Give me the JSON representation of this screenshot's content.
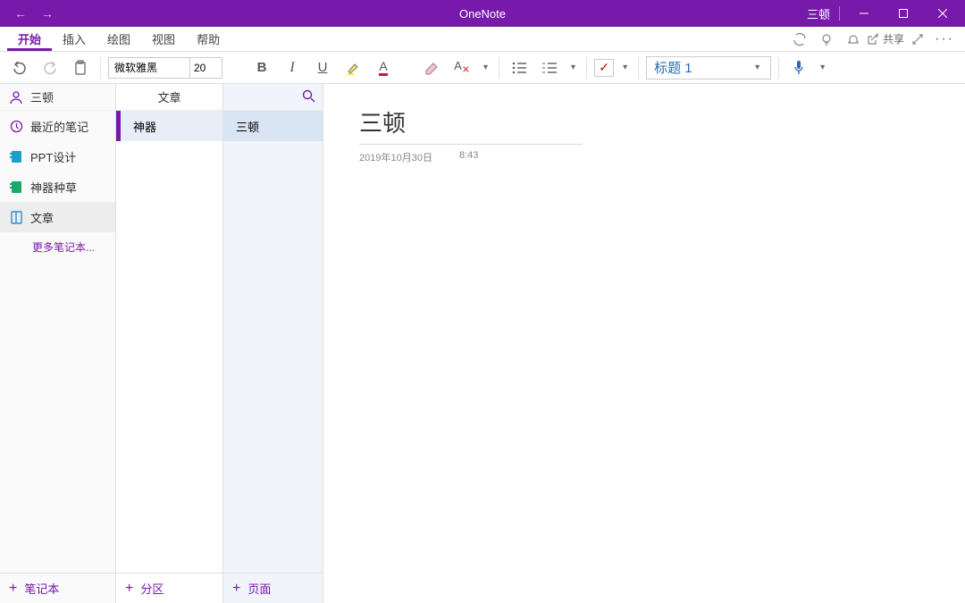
{
  "app": {
    "title": "OneNote",
    "username": "三顿"
  },
  "menu": {
    "tabs": [
      "开始",
      "插入",
      "绘图",
      "视图",
      "帮助"
    ],
    "active": 0,
    "share": "共享"
  },
  "ribbon": {
    "font_name": "微软雅黑",
    "font_size": "20",
    "style_name": "标题 1"
  },
  "sidebar": {
    "user": "三顿",
    "items": [
      {
        "label": "最近的笔记",
        "icon": "clock",
        "color": "#7719AA"
      },
      {
        "label": "PPT设计",
        "icon": "notebook",
        "color": "#1aa0c9"
      },
      {
        "label": "神器种草",
        "icon": "notebook",
        "color": "#1aa86d"
      },
      {
        "label": "文章",
        "icon": "notebook",
        "color": "#2a8dd4",
        "active": true
      }
    ],
    "more": "更多笔记本...",
    "add": "笔记本"
  },
  "sections": {
    "header": "文章",
    "items": [
      {
        "label": "神器",
        "selected": true
      }
    ],
    "add": "分区"
  },
  "pages": {
    "items": [
      {
        "label": "三顿",
        "selected": true
      }
    ],
    "add": "页面"
  },
  "page": {
    "title": "三顿",
    "date": "2019年10月30日",
    "time": "8:43"
  }
}
